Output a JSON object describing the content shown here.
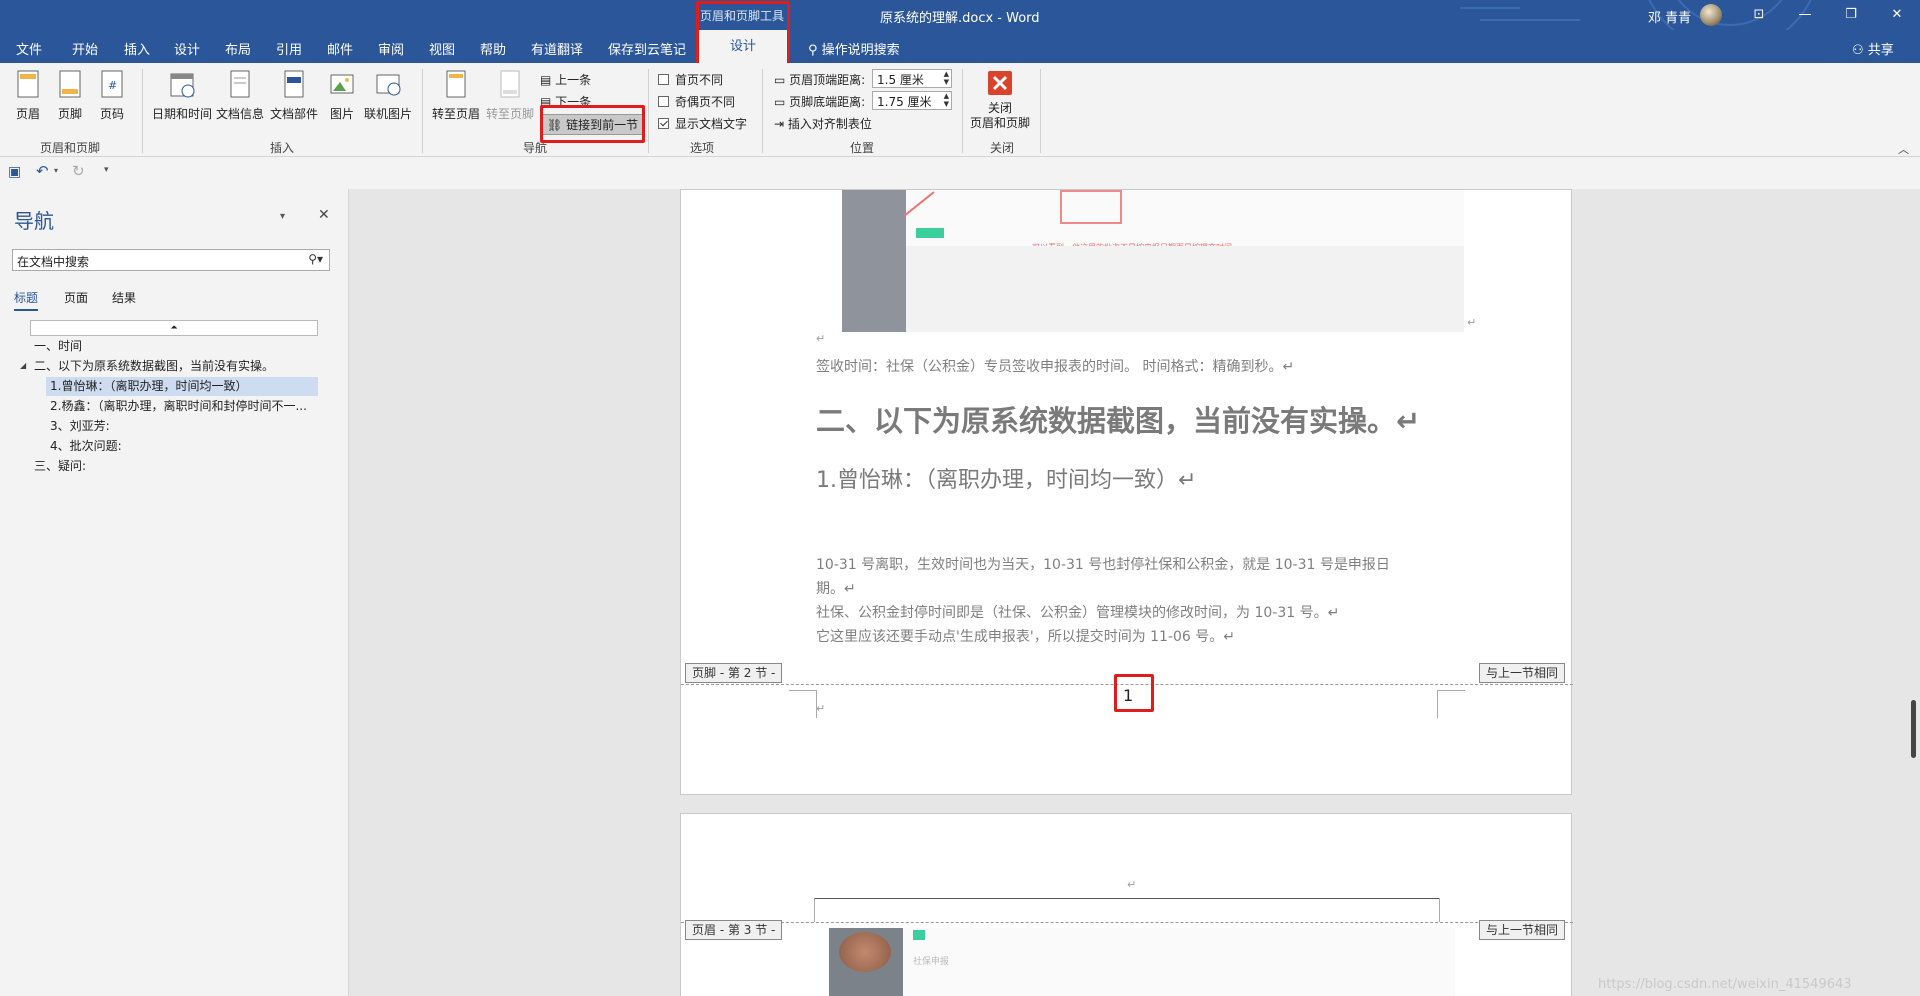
{
  "titlebar": {
    "context_tools": "页眉和页脚工具",
    "title": "原系统的理解.docx  -  Word",
    "user": "邓 青青",
    "buttons": [
      "⊡",
      "—",
      "❐",
      "✕"
    ]
  },
  "tabs": [
    "文件",
    "开始",
    "插入",
    "设计",
    "布局",
    "引用",
    "邮件",
    "审阅",
    "视图",
    "帮助",
    "有道翻译",
    "保存到云笔记"
  ],
  "active_tab": "设计",
  "tell_me": "操作说明搜索",
  "share": "共享",
  "ribbon": {
    "group_hf": {
      "label": "页眉和页脚",
      "buttons": [
        "页眉",
        "页脚",
        "页码"
      ]
    },
    "group_insert": {
      "label": "插入",
      "buttons": [
        "日期和时间",
        "文档信息",
        "文档部件",
        "图片",
        "联机图片"
      ]
    },
    "group_nav": {
      "label": "导航",
      "buttons": [
        "转至页眉",
        "转至页脚"
      ],
      "prev": "上一条",
      "next": "下一条",
      "link": "链接到前一节"
    },
    "group_options": {
      "label": "选项",
      "items": [
        "首页不同",
        "奇偶页不同",
        "显示文档文字"
      ],
      "checked": [
        false,
        false,
        true
      ]
    },
    "group_position": {
      "label": "位置",
      "header_dist_label": "页眉顶端距离:",
      "header_dist": "1.5 厘米",
      "footer_dist_label": "页脚底端距离:",
      "footer_dist": "1.75 厘米",
      "align_tab": "插入对齐制表位"
    },
    "group_close": {
      "label": "关闭",
      "button": "关闭\n页眉和页脚",
      "button_line1": "关闭",
      "button_line2": "页眉和页脚"
    }
  },
  "nav": {
    "title": "导航",
    "search_placeholder": "在文档中搜索",
    "tabs": [
      "标题",
      "页面",
      "结果"
    ],
    "headings": [
      {
        "text": "一、时间",
        "level": 1
      },
      {
        "text": "二、以下为原系统数据截图，当前没有实操。",
        "level": 1
      },
      {
        "text": "1.曾怡琳：（离职办理，时间均一致）",
        "level": 2
      },
      {
        "text": "2.杨鑫：（离职办理，离职时间和封停时间不一...",
        "level": 2
      },
      {
        "text": "3、刘亚芳:",
        "level": 2
      },
      {
        "text": "4、批次问题:",
        "level": 2
      },
      {
        "text": "三、疑问:",
        "level": 1
      }
    ]
  },
  "document": {
    "screenshot_note": "可以看到，他这里的批次不是按申报日期而是按提交时间",
    "sign_time": "签收时间：社保（公积金）专员签收申报表的时间。  时间格式：精确到秒。↵",
    "heading2": "二、以下为原系统数据截图，当前没有实操。↵",
    "heading3": "1.曾怡琳：（离职办理，时间均一致）↵",
    "para1a": "10-31 号离职，生效时间也为当天，10-31 号也封停社保和公积金，就是 10-31 号是申报日",
    "para1b": "期。↵",
    "para2": "社保、公积金封停时间即是（社保、公积金）管理模块的修改时间，为 10-31 号。↵",
    "para3": "它这里应该还要手动点'生成申报表'，所以提交时间为 11-06 号。↵",
    "footer_tag": "页脚 - 第 2 节 -",
    "same_as_prev": "与上一节相同",
    "page_number": "1",
    "header_tag": "页眉 - 第 3 节 -",
    "shebao_title": "社保申报",
    "watermark": "https://blog.csdn.net/weixin_41549643"
  },
  "colors": {
    "word_blue": "#2b579a",
    "highlight_red": "#e21b1b",
    "ribbon_bg": "#f3f3f3"
  }
}
